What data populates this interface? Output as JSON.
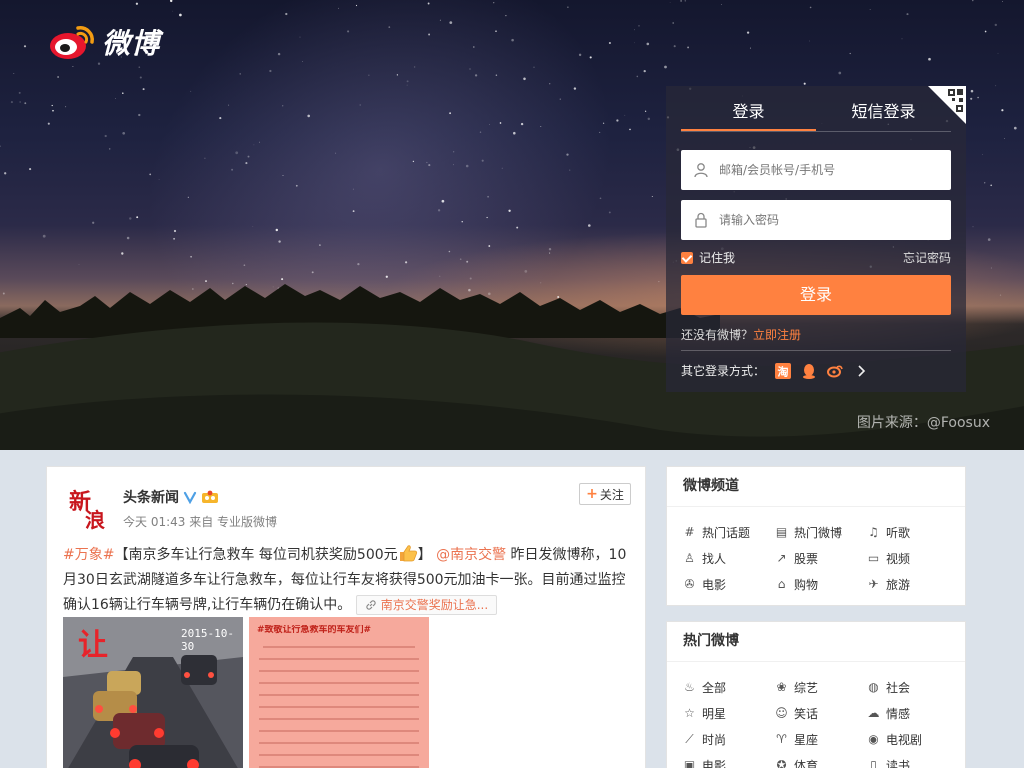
{
  "brand": {
    "name": "微博"
  },
  "photo_credit": "图片来源：@Foosux",
  "login": {
    "tabs": [
      {
        "label": "登录",
        "active": true
      },
      {
        "label": "短信登录",
        "active": false
      }
    ],
    "username_placeholder": "邮箱/会员帐号/手机号",
    "password_placeholder": "请输入密码",
    "remember_label": "记住我",
    "remember_checked": true,
    "forgot_label": "忘记密码",
    "submit_label": "登录",
    "no_account_text": "还没有微博？",
    "signup_label": "立即注册",
    "other_login_label": "其它登录方式：",
    "other_login_icons": [
      "taobao-icon",
      "qq-icon",
      "tianyi-icon"
    ],
    "accent_color": "#ff8140"
  },
  "post": {
    "author": "头条新闻",
    "meta": "今天 01:43 来自 专业版微博",
    "follow_label": "关注",
    "topic": "#万象#",
    "body_1": "【南京多车让行急救车 每位司机获奖励500元",
    "body_2": "】",
    "mention": "@南京交警",
    "body_3": " 昨日发微博称，10月30日玄武湖隧道多车让行急救车，每位让行车友将获得500元加油卡一张。目前通过监控确认16辆让行车辆号牌,让行车辆仍在确认中。",
    "link_label": "南京交警奖励让急...",
    "image1_stamp": "2015-10-30",
    "image2_title": "#致敬让行急救车的车友们#",
    "link_color": "#eb7350"
  },
  "channels": {
    "title": "微博频道",
    "items": [
      {
        "icon": "hash-icon",
        "label": "热门话题"
      },
      {
        "icon": "doc-icon",
        "label": "热门微博"
      },
      {
        "icon": "music-icon",
        "label": "听歌"
      },
      {
        "icon": "person-search-icon",
        "label": "找人"
      },
      {
        "icon": "stock-icon",
        "label": "股票"
      },
      {
        "icon": "video-icon",
        "label": "视频"
      },
      {
        "icon": "film-icon",
        "label": "电影"
      },
      {
        "icon": "tag-icon",
        "label": "购物"
      },
      {
        "icon": "plane-icon",
        "label": "旅游"
      }
    ]
  },
  "hot": {
    "title": "热门微博",
    "items": [
      {
        "icon": "fire-icon",
        "label": "全部"
      },
      {
        "icon": "variety-icon",
        "label": "综艺"
      },
      {
        "icon": "globe-icon",
        "label": "社会"
      },
      {
        "icon": "star-icon",
        "label": "明星"
      },
      {
        "icon": "smile-icon",
        "label": "笑话"
      },
      {
        "icon": "cloud-icon",
        "label": "情感"
      },
      {
        "icon": "shoe-icon",
        "label": "时尚"
      },
      {
        "icon": "aries-icon",
        "label": "星座"
      },
      {
        "icon": "tv-icon",
        "label": "电视剧"
      },
      {
        "icon": "film-icon",
        "label": "电影"
      },
      {
        "icon": "sports-icon",
        "label": "体育"
      },
      {
        "icon": "book-icon",
        "label": "读书"
      }
    ]
  }
}
